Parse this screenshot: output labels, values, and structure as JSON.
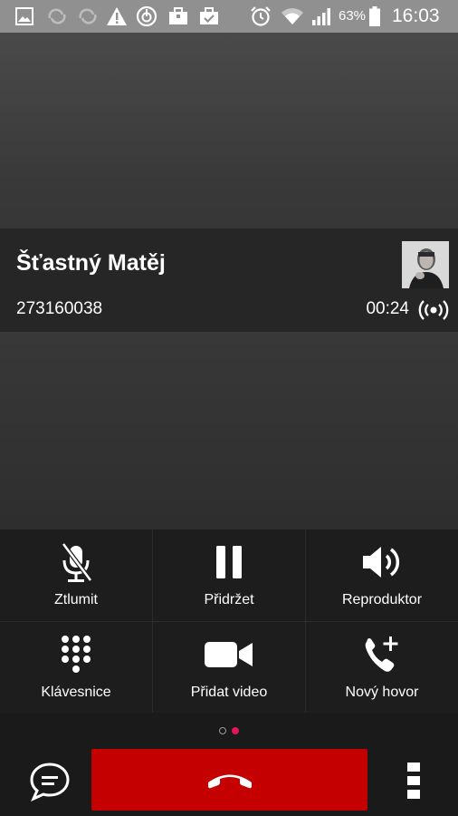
{
  "status_bar": {
    "battery_percent": "63%",
    "time": "16:03",
    "icons": [
      "gallery-icon",
      "sync-icon",
      "sync-icon",
      "warning-icon",
      "power-icon",
      "briefcase-icon",
      "briefcase-check-icon",
      "alarm-icon",
      "wifi-icon",
      "signal-icon",
      "battery-icon"
    ]
  },
  "call": {
    "caller_name": "Šťastný Matěj",
    "caller_number": "273160038",
    "duration": "00:24"
  },
  "actions": {
    "mute": "Ztlumit",
    "hold": "Přidržet",
    "speaker": "Reproduktor",
    "keypad": "Klávesnice",
    "add_video": "Přidat video",
    "new_call": "Nový hovor"
  },
  "pager": {
    "total": 2,
    "active": 2,
    "active_color": "#e0155a"
  },
  "colors": {
    "end_call": "#c40000",
    "status_bar": "#909090"
  }
}
